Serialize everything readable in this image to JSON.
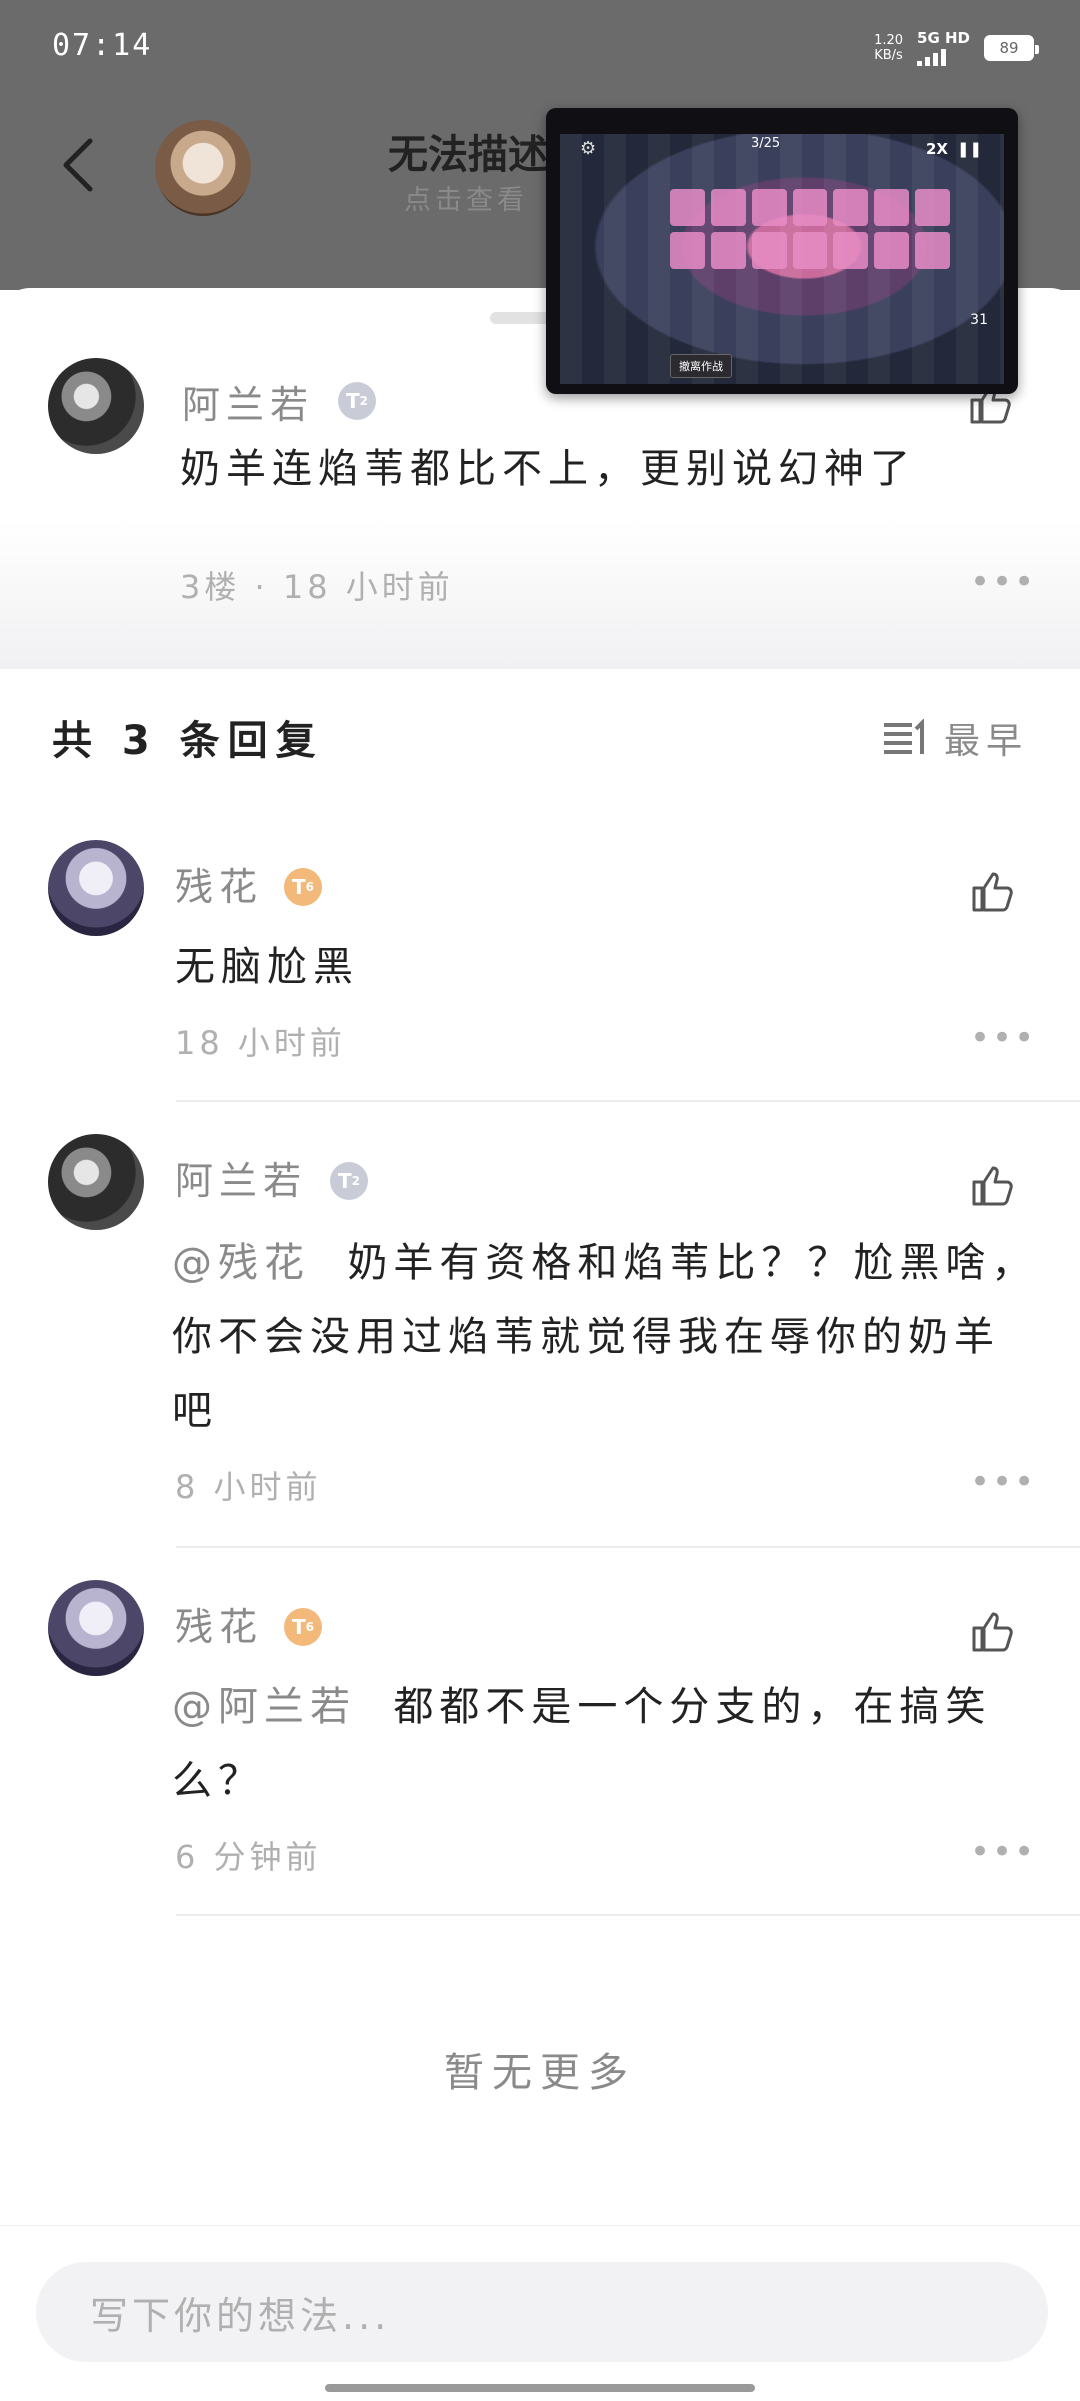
{
  "status_bar": {
    "time": "07:14",
    "net_speed_value": "1.20",
    "net_speed_unit": "KB/s",
    "network": "5G HD",
    "battery": "89"
  },
  "topbar": {
    "title": "无法描述",
    "subtitle": "点击查看"
  },
  "floating_video": {
    "wave": "3/25",
    "speed": "2X",
    "count": "31",
    "button_label": "撤离作战"
  },
  "main_comment": {
    "author": "阿兰若",
    "level": "2",
    "text": "奶羊连焰苇都比不上，更别说幻神了",
    "meta": "3楼 · 18 小时前"
  },
  "replies_header": {
    "title": "共 3 条回复",
    "sort_label": "最早"
  },
  "replies": [
    {
      "author": "残花",
      "level": "6",
      "mention": "",
      "text": "无脑尬黑",
      "text_line2": "",
      "text_line3": "",
      "time": "18 小时前"
    },
    {
      "author": "阿兰若",
      "level": "2",
      "mention": "@残花",
      "text": "奶羊有资格和焰苇比？？尬黑啥，",
      "text_line2": "你不会没用过焰苇就觉得我在辱你的奶羊",
      "text_line3": "吧",
      "time": "8 小时前"
    },
    {
      "author": "残花",
      "level": "6",
      "mention": "@阿兰若",
      "text": "都都不是一个分支的，在搞笑",
      "text_line2": "么？",
      "text_line3": "",
      "time": "6 分钟前"
    }
  ],
  "no_more": "暂无更多",
  "input": {
    "placeholder": "写下你的想法..."
  },
  "colors": {
    "accent_gold": "#f2b97a",
    "accent_silver": "#c9ccd6",
    "muted_text": "#8a8a8a"
  }
}
